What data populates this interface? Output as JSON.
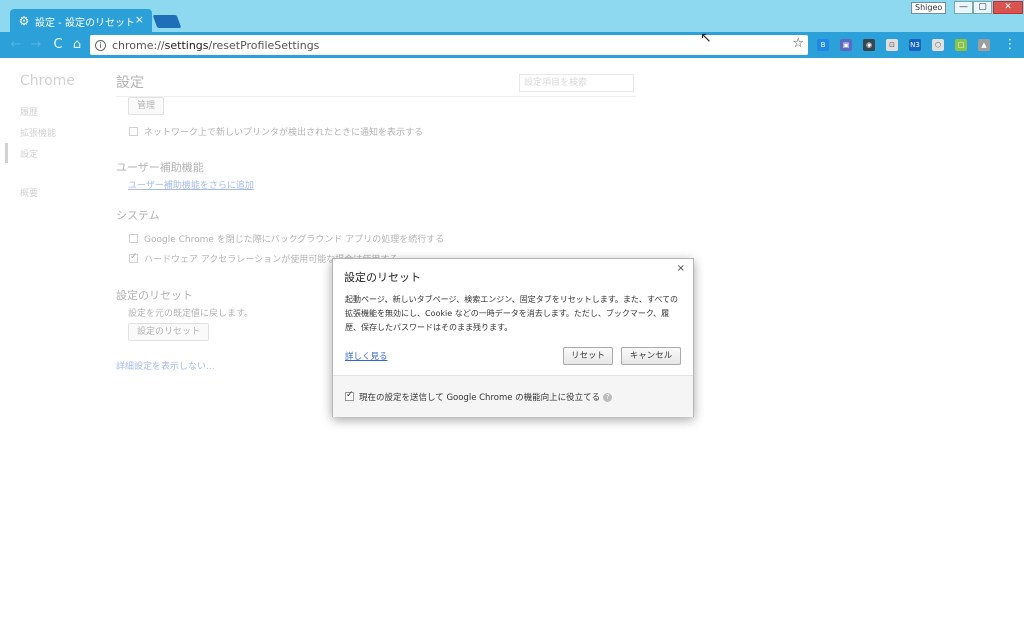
{
  "tab": {
    "title": "設定 - 設定のリセット",
    "close": "×"
  },
  "window": {
    "user": "Shigeo",
    "minimize": "—",
    "maximize": "▢",
    "close": "✕"
  },
  "toolbar": {
    "url_prefix": "chrome://",
    "url_path": "settings",
    "url_rest": "/resetProfileSettings",
    "info_icon": "i",
    "star": "☆",
    "back": "←",
    "forward": "→",
    "reload": "C",
    "home": "⌂",
    "extensions": [
      "B",
      "▣",
      "◉",
      "⊡",
      "N3",
      "⬡",
      "□",
      "▲"
    ]
  },
  "colors": {
    "tab": "#2ba0d9",
    "titlebar": "#8fd9f0",
    "link": "#3367d6"
  },
  "sidebar": {
    "brand": "Chrome",
    "items": [
      "履歴",
      "拡張機能",
      "設定",
      "概要"
    ]
  },
  "settings": {
    "heading": "設定",
    "search_placeholder": "設定項目を検索",
    "manage_button": "管理",
    "printer_notify": "ネットワーク上で新しいプリンタが検出されたときに通知を表示する",
    "accessibility_heading": "ユーザー補助機能",
    "accessibility_link": "ユーザー補助機能をさらに追加",
    "system_heading": "システム",
    "background_apps": "Google Chrome を閉じた際にバックグラウンド アプリの処理を続行する",
    "hardware_accel": "ハードウェア アクセラレーションが使用可能な場合は使用する",
    "reset_heading": "設定のリセット",
    "reset_desc": "設定を元の既定値に戻します。",
    "reset_button": "設定のリセット",
    "hide_advanced": "詳細設定を表示しない..."
  },
  "dialog": {
    "title": "設定のリセット",
    "close": "×",
    "body": "起動ページ、新しいタブページ、検索エンジン、固定タブをリセットします。また、すべての拡張機能を無効にし、Cookie などの一時データを消去します。ただし、ブックマーク、履歴、保存したパスワードはそのまま残ります。",
    "learn_more": "詳しく見る",
    "reset_button": "リセット",
    "cancel_button": "キャンセル",
    "feedback_label": "現在の設定を送信して Google Chrome の機能向上に役立てる",
    "feedback_checked": true,
    "help_icon": "?"
  }
}
